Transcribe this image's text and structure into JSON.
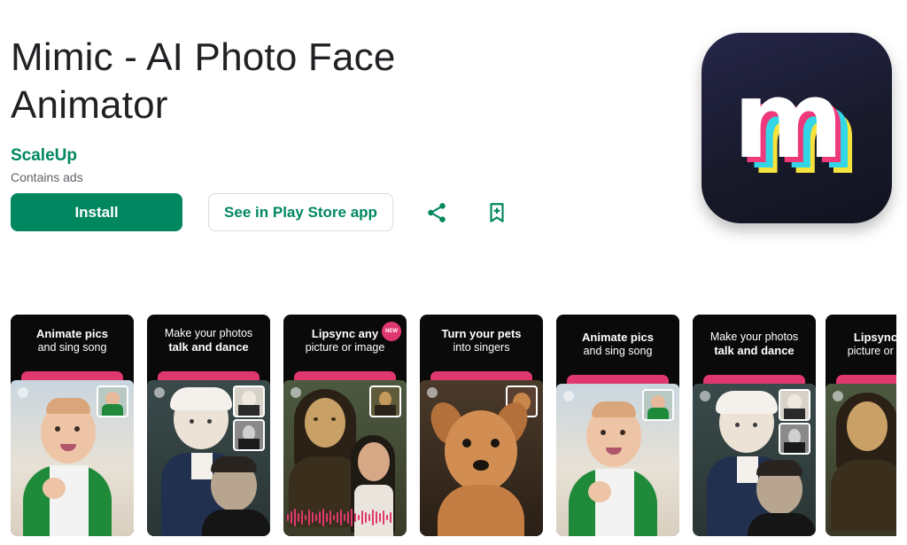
{
  "app": {
    "title": "Mimic - AI Photo Face Animator",
    "developer": "ScaleUp",
    "ads_notice": "Contains ads"
  },
  "actions": {
    "install_label": "Install",
    "store_label": "See in Play Store app",
    "share_icon": "share-icon",
    "wishlist_icon": "bookmark-add-icon"
  },
  "colors": {
    "accent": "#01875f",
    "pink": "#e0386e",
    "icon_bg": "#1a1b2e"
  },
  "icon_letter": "m",
  "screenshots": [
    {
      "line1": "Animate pics",
      "line2": "and sing song"
    },
    {
      "line1": "Make your photos",
      "line2": "talk and dance"
    },
    {
      "line1": "Lipsync any",
      "line2": "picture or image",
      "badge": "NEW"
    },
    {
      "line1": "Turn your pets",
      "line2": "into singers"
    },
    {
      "line1": "Animate pics",
      "line2": "and sing song"
    },
    {
      "line1": "Make your photos",
      "line2": "talk and dance"
    },
    {
      "line1": "Lipsync any",
      "line2": "picture or image"
    }
  ]
}
